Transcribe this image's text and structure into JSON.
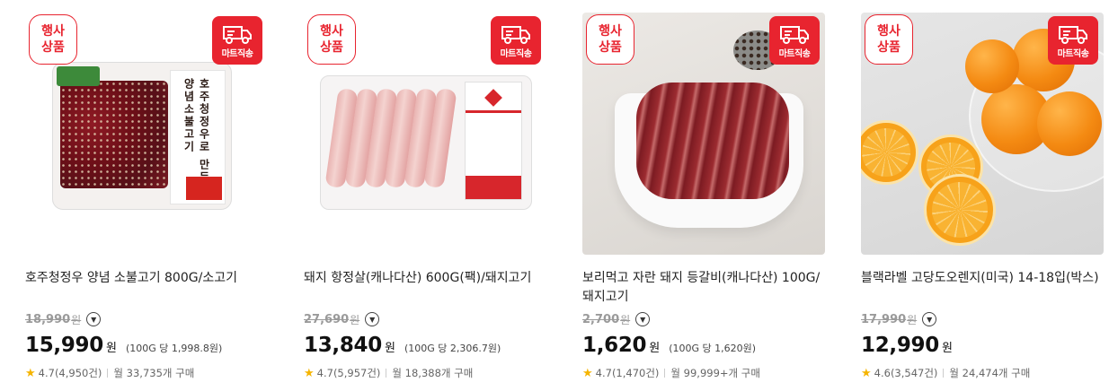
{
  "badges": {
    "event": "행사\n상품",
    "mart": "마트직송"
  },
  "products": [
    {
      "title": "호주청정우 양념 소불고기 800G/소고기",
      "original_price": "18,990",
      "original_unit": "원",
      "price": "15,990",
      "price_unit": "원",
      "unit_price": "(100G 당 1,998.8원)",
      "rating": "4.7(4,950건)",
      "purchases": "월 33,735개 구매",
      "label_text": "호주청정우로 만든 양념소불고기"
    },
    {
      "title": "돼지 항정살(캐나다산) 600G(팩)/돼지고기",
      "original_price": "27,690",
      "original_unit": "원",
      "price": "13,840",
      "price_unit": "원",
      "unit_price": "(100G 당 2,306.7원)",
      "rating": "4.7(5,957건)",
      "purchases": "월 18,388개 구매"
    },
    {
      "title": "보리먹고 자란 돼지 등갈비(캐나다산) 100G/돼지고기",
      "original_price": "2,700",
      "original_unit": "원",
      "price": "1,620",
      "price_unit": "원",
      "unit_price": "(100G 당 1,620원)",
      "rating": "4.7(1,470건)",
      "purchases": "월 99,999+개 구매"
    },
    {
      "title": "블랙라벨 고당도오렌지(미국) 14-18입(박스)",
      "original_price": "17,990",
      "original_unit": "원",
      "price": "12,990",
      "price_unit": "원",
      "unit_price": "",
      "rating": "4.6(3,547건)",
      "purchases": "월 24,474개 구매"
    }
  ],
  "colors": {
    "accent_red": "#e8242f",
    "star": "#f5b400"
  }
}
